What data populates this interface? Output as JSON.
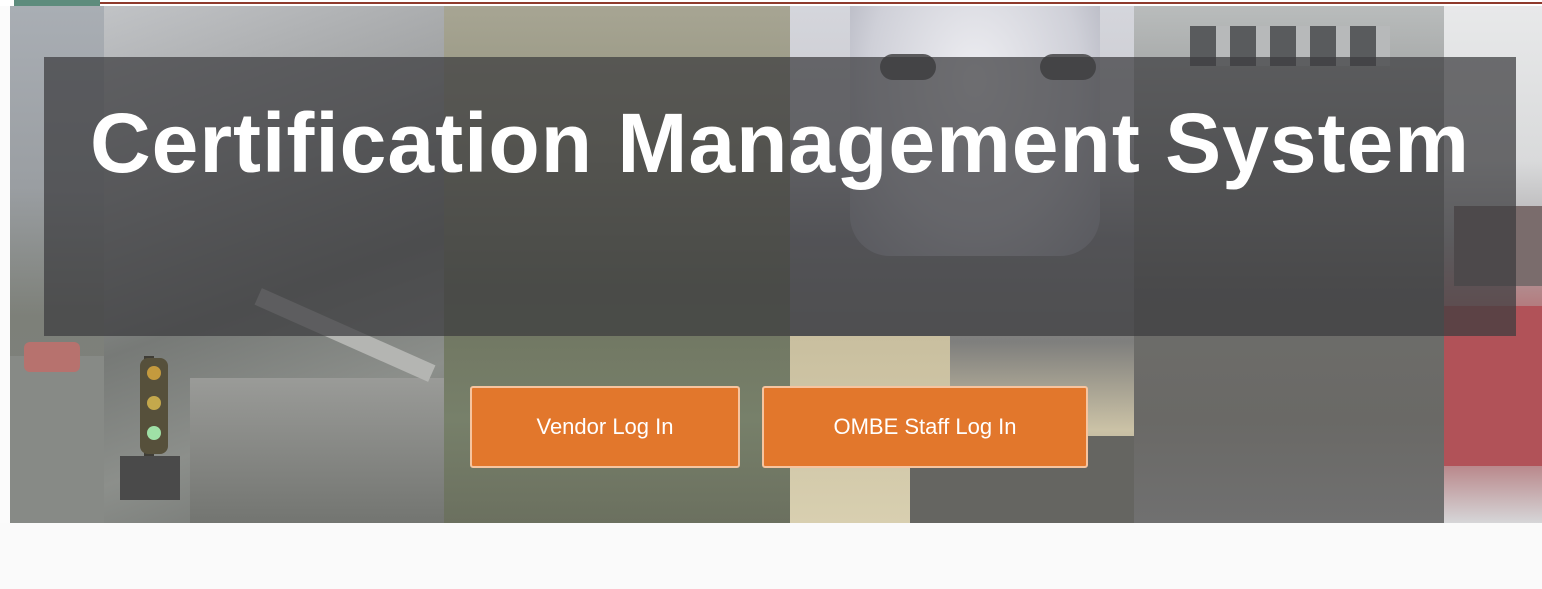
{
  "hero": {
    "title": "Certification Management System",
    "background_image_description_icon": "transportation-collage-image"
  },
  "actions": {
    "vendor_login_label": "Vendor Log In",
    "staff_login_label": "OMBE Staff Log In"
  },
  "colors": {
    "button_background": "#e2772c",
    "button_border": "#f6c49f",
    "title_band": "#3c3c3e",
    "title_text": "#ffffff"
  }
}
